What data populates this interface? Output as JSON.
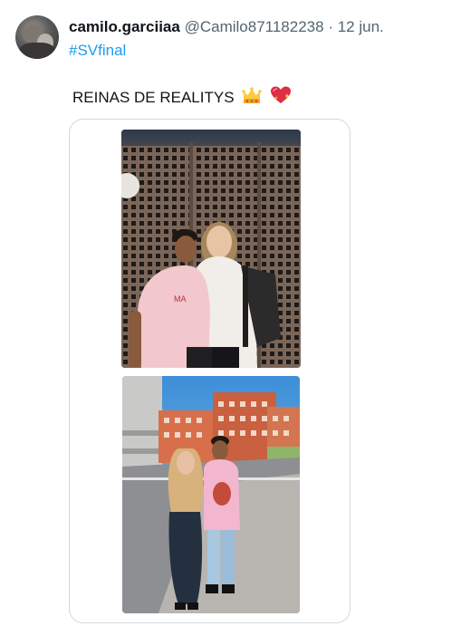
{
  "tweet": {
    "author_name": "camilo.garciiaa",
    "author_handle": "@Camilo871182238",
    "separator": "·",
    "date": "12 jun.",
    "hashtag": "#SVfinal",
    "text": "REINAS DE REALITYS",
    "emojis": [
      "crown-emoji",
      "sparkling-heart-emoji"
    ]
  },
  "colors": {
    "text_primary": "#0f1419",
    "text_secondary": "#536471",
    "link": "#1d9bf0",
    "card_border": "#cfd9de"
  },
  "media": {
    "photos": [
      {
        "description_icon": "photo-two-people-perforated-wall"
      },
      {
        "description_icon": "photo-two-people-street"
      }
    ]
  }
}
